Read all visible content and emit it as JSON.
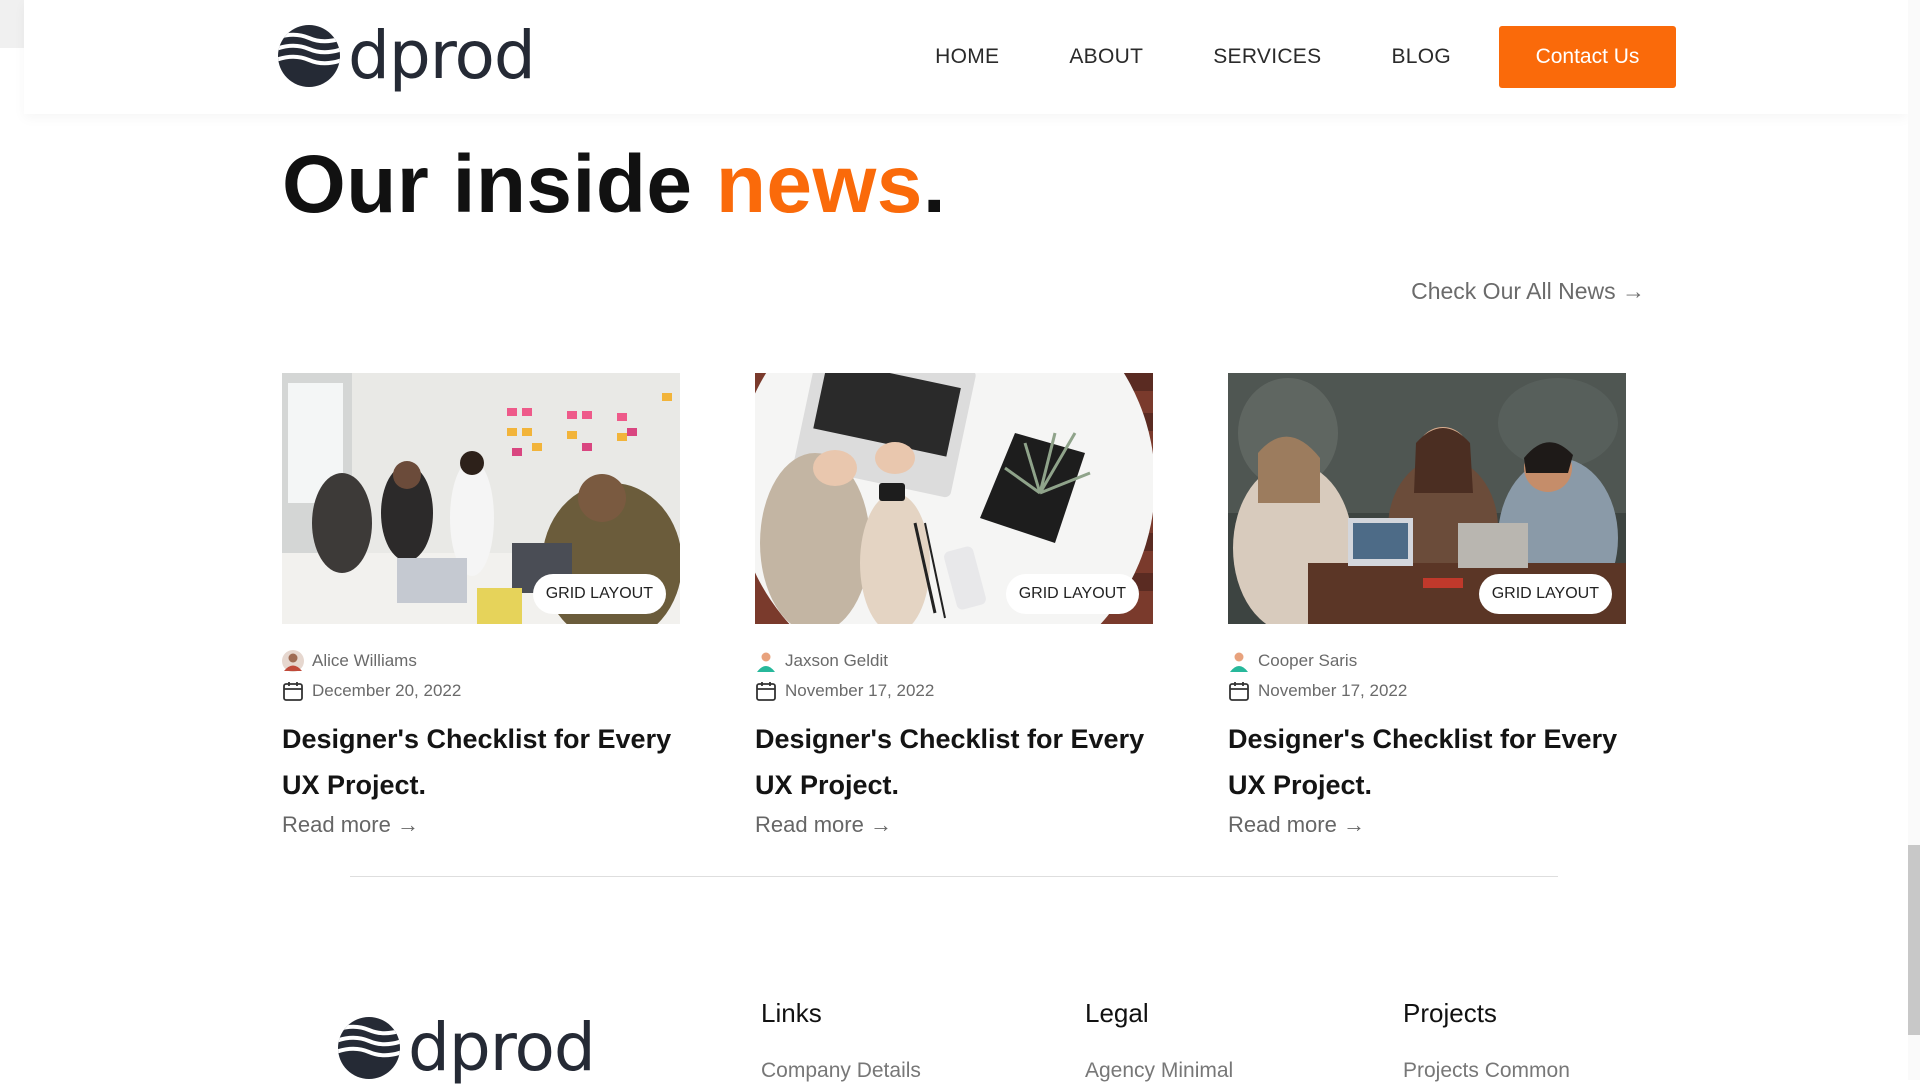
{
  "brand": {
    "name": "dprod",
    "color": "#252a35"
  },
  "accent_color": "#fa6a0a",
  "nav": {
    "items": [
      {
        "label": "HOME"
      },
      {
        "label": "ABOUT"
      },
      {
        "label": "SERVICES"
      },
      {
        "label": "BLOG"
      }
    ],
    "contact_label": "Contact Us"
  },
  "section": {
    "title_main": "Our inside ",
    "title_accent": "news",
    "title_end": ".",
    "check_all": "Check Our All News →"
  },
  "posts": [
    {
      "badge": "GRID LAYOUT",
      "author": "Alice Williams",
      "date": "December 20, 2022",
      "title": "Designer's Checklist for Every UX Project.",
      "read_more": "Read more →",
      "image_icon": "team-meeting-photo"
    },
    {
      "badge": "GRID LAYOUT",
      "author": "Jaxson Geldit",
      "date": "November 17, 2022",
      "title": "Designer's Checklist for Every UX Project.",
      "read_more": "Read more →",
      "image_icon": "laptop-desk-photo"
    },
    {
      "badge": "GRID LAYOUT",
      "author": "Cooper Saris",
      "date": "November 17, 2022",
      "title": "Designer's Checklist for Every UX Project.",
      "read_more": "Read more →",
      "image_icon": "coworkers-cafe-photo"
    }
  ],
  "footer": {
    "columns": [
      {
        "heading": "Links",
        "first_link": "Company Details"
      },
      {
        "heading": "Legal",
        "first_link": "Agency Minimal"
      },
      {
        "heading": "Projects",
        "first_link": "Projects Common"
      }
    ]
  }
}
